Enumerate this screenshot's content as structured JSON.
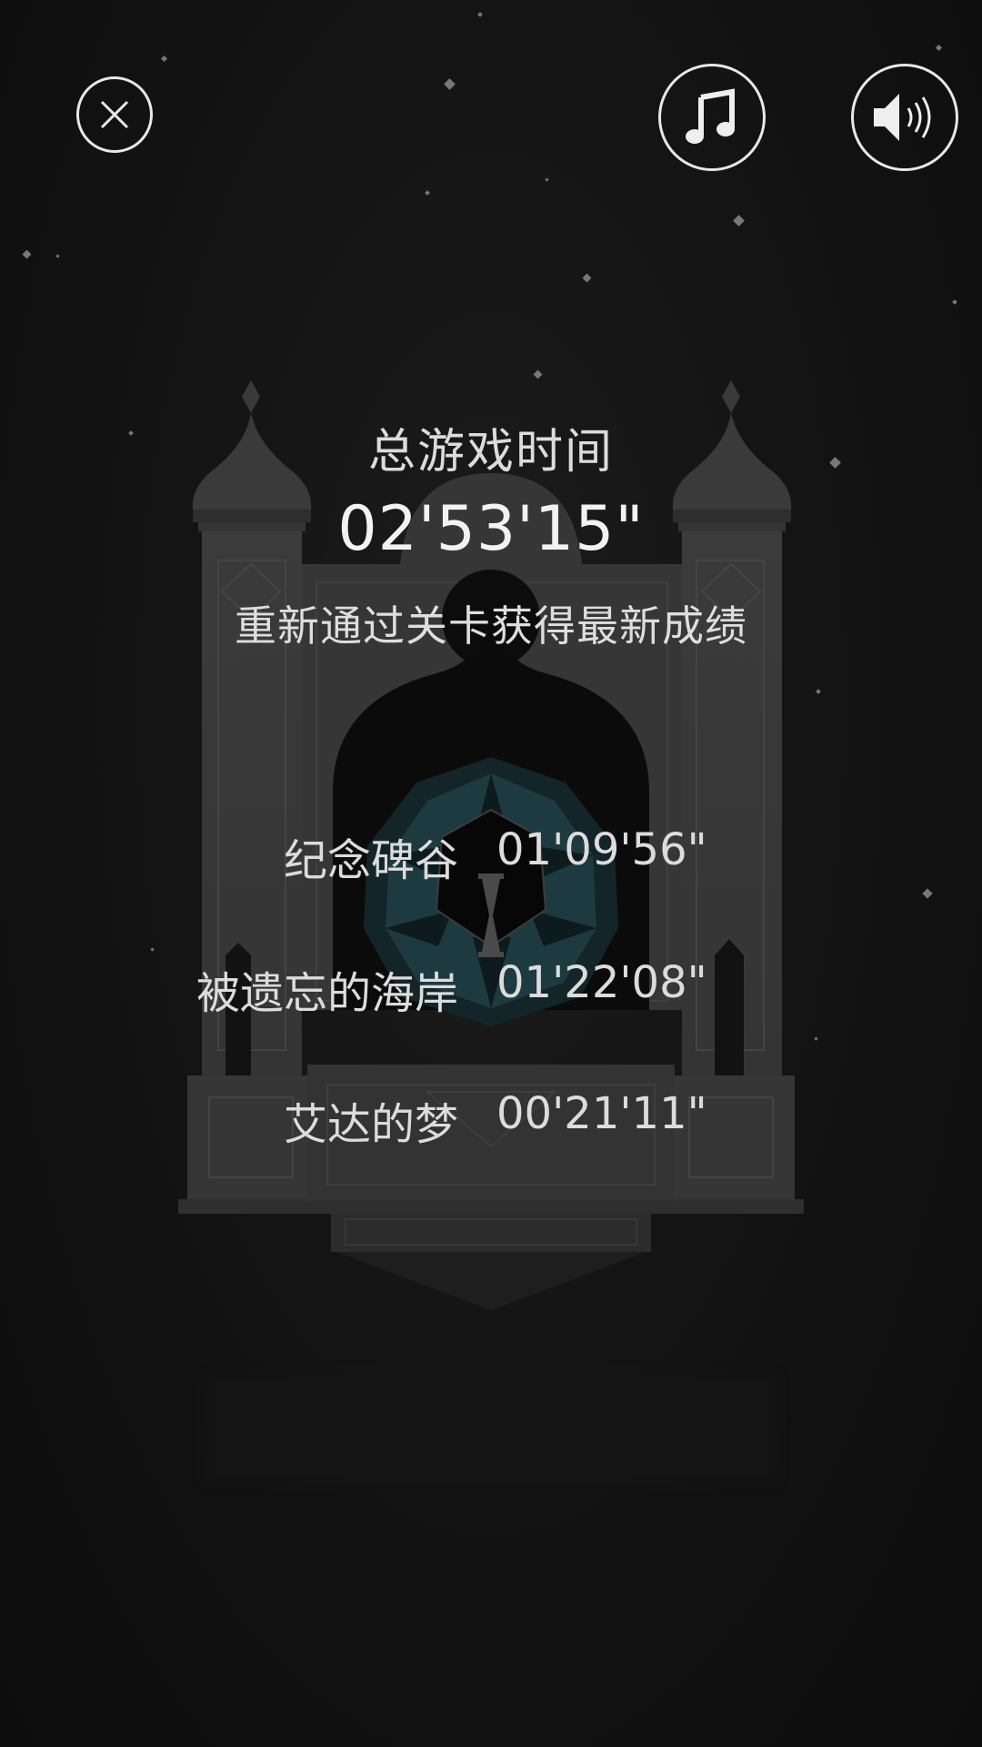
{
  "stats": {
    "total_label": "总游戏时间",
    "total_time": "02'53'15\"",
    "replay_hint": "重新通过关卡获得最新成绩"
  },
  "levels": [
    {
      "name": "纪念碑谷",
      "time": "01'09'56\""
    },
    {
      "name": "被遗忘的海岸",
      "time": "01'22'08\""
    },
    {
      "name": "艾达的梦",
      "time": "00'21'11\""
    }
  ],
  "icons": {
    "close": "close-icon",
    "music": "music-note-icon",
    "sound": "speaker-icon"
  },
  "colors": {
    "background": "#111111",
    "text": "#e6e6e6",
    "monument": "#3a3a3a",
    "accent_teal": "#1f3f46"
  }
}
